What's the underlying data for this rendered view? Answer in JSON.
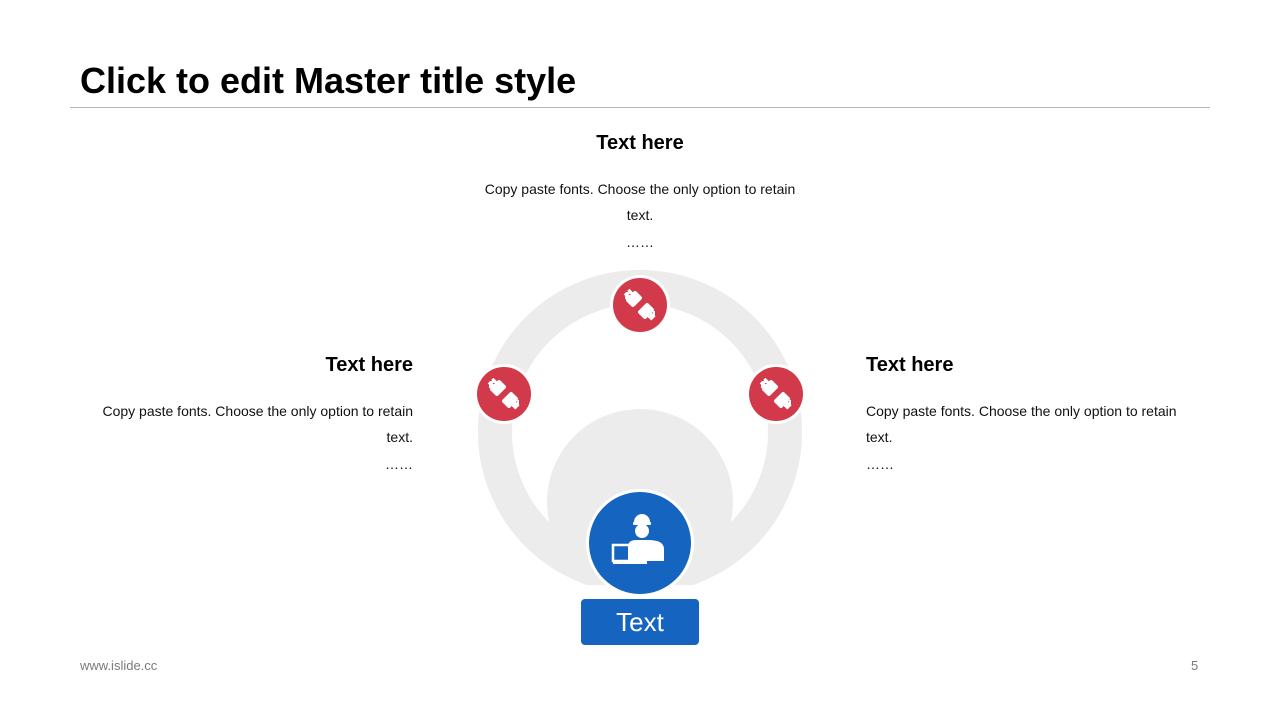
{
  "title": "Click to edit Master title style",
  "colors": {
    "accent_red": "#d23a4b",
    "accent_blue": "#1565c0",
    "ring": "#ececec"
  },
  "blocks": {
    "top": {
      "heading": "Text here",
      "body": "Copy paste fonts. Choose the only option to retain text.",
      "dots": "……"
    },
    "left": {
      "heading": "Text here",
      "body": "Copy paste fonts. Choose the only option to retain text.",
      "dots": "……"
    },
    "right": {
      "heading": "Text here",
      "body": "Copy paste fonts. Choose the only option to retain text.",
      "dots": "……"
    }
  },
  "icons": {
    "node": "plug-connector-icon",
    "center": "presenter-laptop-icon"
  },
  "center_label": "Text",
  "footer": {
    "url": "www.islide.cc",
    "page_number": "5"
  }
}
